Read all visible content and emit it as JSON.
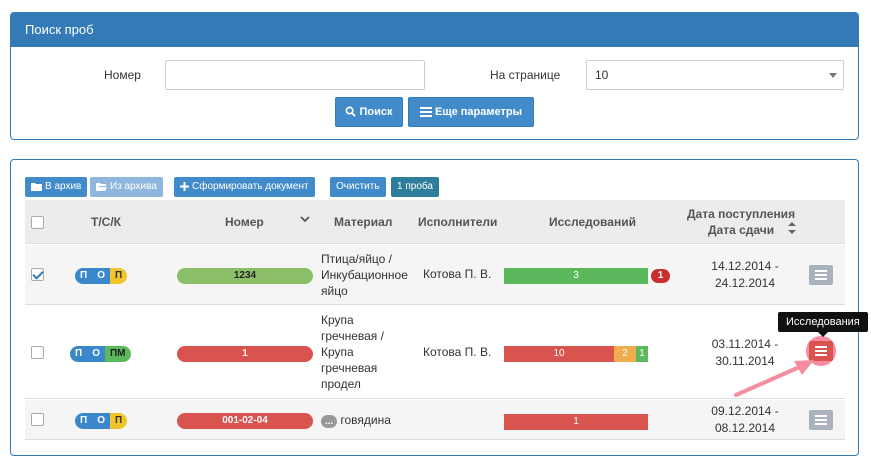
{
  "search_panel": {
    "title": "Поиск проб",
    "number_label": "Номер",
    "number_value": "",
    "per_page_label": "На странице",
    "per_page_value": "10",
    "search_button": "Поиск",
    "more_button": "Еще параметры"
  },
  "toolbar": {
    "to_archive": "В архив",
    "from_archive": "Из архива",
    "create_doc": "Сформировать документ",
    "clear": "Очистить",
    "count": "1 проба"
  },
  "table": {
    "headers": {
      "tcs": "Т/С/К",
      "number": "Номер",
      "material": "Материал",
      "executors": "Исполнители",
      "studies": "Исследований",
      "date_line1": "Дата поступления",
      "date_line2": "Дата сдачи"
    },
    "rows": [
      {
        "checked": true,
        "tcs": [
          "П",
          "О",
          "П"
        ],
        "number": "1234",
        "material_lines": [
          "Птица/яйцо /",
          "Инкубационное",
          "яйцо"
        ],
        "executor": "Котова П. В.",
        "bar": [
          "3"
        ],
        "badge": "1",
        "date_start": "14.12.2014 -",
        "date_end": "24.12.2014"
      },
      {
        "checked": false,
        "tcs": [
          "П",
          "О",
          "ПМ"
        ],
        "number": "1",
        "material_lines": [
          "Крупа",
          "гречневая /",
          "Крупа",
          "гречневая",
          "продел"
        ],
        "executor": "Котова П. В.",
        "bar": [
          "10",
          "2",
          "1"
        ],
        "date_start": "03.11.2014 -",
        "date_end": "30.11.2014"
      },
      {
        "checked": false,
        "tcs": [
          "П",
          "О",
          "П"
        ],
        "number": "001-02-04",
        "material_ellipsis": "...",
        "material": "говядина",
        "executor": "",
        "bar": [
          "1"
        ],
        "date_start": "09.12.2014 -",
        "date_end": "08.12.2014"
      }
    ]
  },
  "tooltip": "Исследования",
  "colors": {
    "primary": "#337ab7",
    "success": "#5cb85c",
    "danger": "#d9534f",
    "warning": "#f0ad4e",
    "highlight": "#f58ca0"
  }
}
